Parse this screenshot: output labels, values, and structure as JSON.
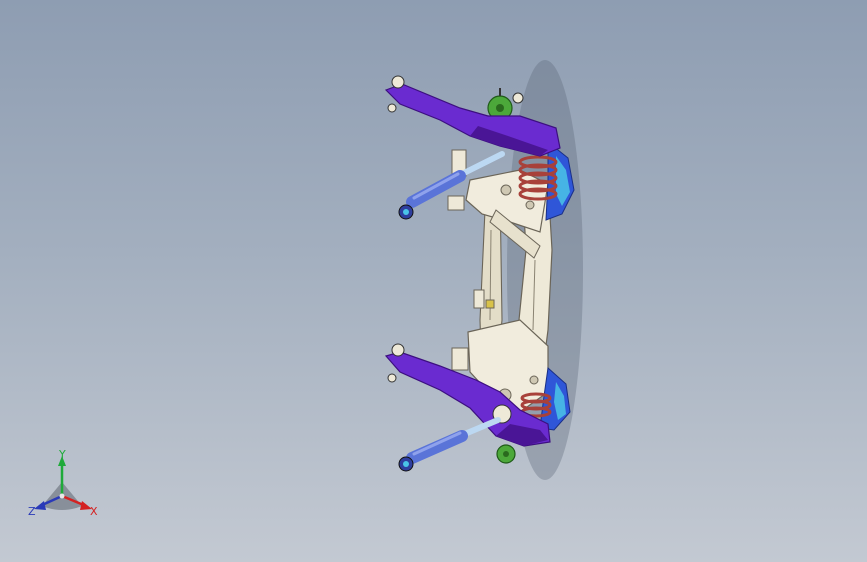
{
  "viewport": {
    "background_top": "#8e9db2",
    "background_bottom": "#c3c9d2"
  },
  "model": {
    "colors": {
      "arm_purple": "#6a2bd0",
      "arm_purple_dark": "#4a1596",
      "knuckle_blue": "#2f56d8",
      "coil_red": "#a8413a",
      "shock_blue": "#5a74d8",
      "shock_rod": "#bcd8f2",
      "subframe_cream": "#eee9d8",
      "subframe_edge": "#6b6558",
      "hub_green": "#4ca83a",
      "mount_cyan": "#4ac4e8"
    }
  },
  "triad": {
    "x_label": "X",
    "y_label": "Y",
    "z_label": "Z",
    "x_color": "#d42222",
    "y_color": "#1faa3a",
    "z_color": "#2a3ab8"
  }
}
